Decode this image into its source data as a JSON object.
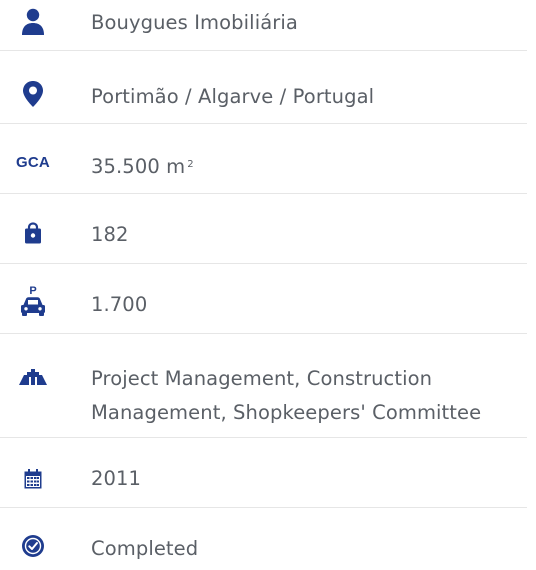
{
  "colors": {
    "icon": "#1f3c8e",
    "text": "#5a5f66",
    "divider": "#e6e6e6"
  },
  "details": {
    "client": {
      "icon": "person-icon",
      "value": "Bouygues Imobiliária"
    },
    "location": {
      "icon": "map-pin-icon",
      "value": "Portimão / Algarve / Portugal"
    },
    "gca": {
      "icon_label": "GCA",
      "value": "35.500 m",
      "superscript": "2"
    },
    "shops": {
      "icon": "shopping-bag-icon",
      "value": "182"
    },
    "parking": {
      "icon": "parking-car-icon",
      "value": "1.700"
    },
    "services": {
      "icon": "crane-structure-icon",
      "line1": "Project Management, Construction",
      "line2": "Management, Shopkeepers' Committee"
    },
    "year": {
      "icon": "calendar-icon",
      "value": "2011"
    },
    "status": {
      "icon": "check-circle-icon",
      "value": "Completed"
    }
  }
}
